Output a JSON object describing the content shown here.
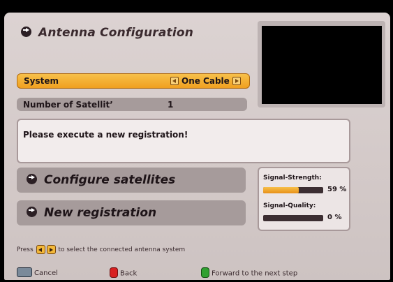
{
  "screen": {
    "title": "Antenna Configuration"
  },
  "settings": {
    "system_label": "System",
    "system_value": "One Cable",
    "satellites_label": "Number of Satellit’",
    "satellites_value": "1"
  },
  "message": "Please execute a new registration!",
  "buttons": {
    "configure": "Configure satellites",
    "registration": "New registration"
  },
  "signal": {
    "strength_label": "Signal-Strength:",
    "strength_value": 59,
    "strength_text": "59 %",
    "quality_label": "Signal-Quality:",
    "quality_value": 0,
    "quality_text": "0 %"
  },
  "hint": {
    "prefix": "Press",
    "suffix": "to select the connected antenna system"
  },
  "footer": {
    "cancel": "Cancel",
    "back": "Back",
    "forward": "Forward to the next step"
  },
  "colors": {
    "highlight": "#f0a020",
    "panel": "#d6cccb"
  }
}
